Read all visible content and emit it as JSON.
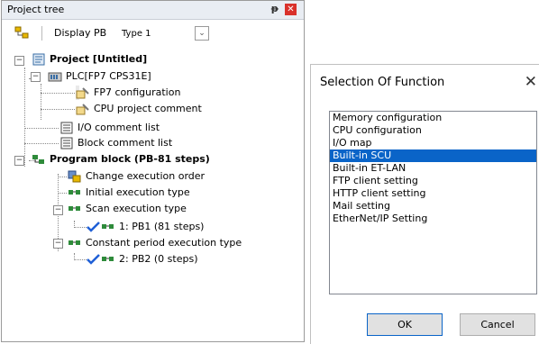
{
  "tree_panel": {
    "title": "Project tree",
    "pin_glyph": "ᵽ",
    "close_glyph": "x",
    "toolbar": {
      "display_label": "Display PB",
      "type_label": "Type 1"
    },
    "nodes": [
      {
        "label": "Project [Untitled]",
        "icon": "project-icon"
      },
      {
        "label": "PLC[FP7 CPS31E]",
        "icon": "plc-icon"
      },
      {
        "label": "FP7 configuration",
        "icon": "configuration-icon"
      },
      {
        "label": "CPU project comment",
        "icon": "comment-icon"
      },
      {
        "label": "I/O comment list",
        "icon": "list-icon"
      },
      {
        "label": "Block comment list",
        "icon": "list-icon"
      },
      {
        "label": "Program block (PB-81 steps)",
        "icon": "program-block-icon"
      },
      {
        "label": "Change execution order",
        "icon": "order-icon"
      },
      {
        "label": "Initial execution type",
        "icon": "block-icon"
      },
      {
        "label": "Scan execution type",
        "icon": "block-icon"
      },
      {
        "label": "1: PB1 (81 steps)",
        "icon": "checked-block-icon"
      },
      {
        "label": "Constant period execution type",
        "icon": "block-icon"
      },
      {
        "label": "2: PB2 (0 steps)",
        "icon": "checked-block-icon"
      }
    ]
  },
  "dialog": {
    "title": "Selection Of Function",
    "close_glyph": "✕",
    "items": [
      "Memory configuration",
      "CPU configuration",
      "I/O map",
      "Built-in SCU",
      "Built-in ET-LAN",
      "FTP client setting",
      "HTTP client setting",
      "Mail setting",
      "EtherNet/IP Setting"
    ],
    "selected_item": "Built-in SCU",
    "ok_label": "OK",
    "cancel_label": "Cancel",
    "accent_color": "#0a64c8"
  }
}
